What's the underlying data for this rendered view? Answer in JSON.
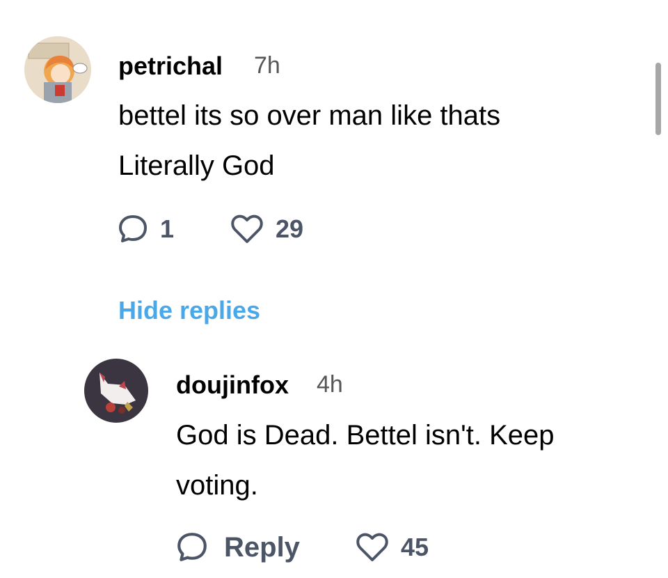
{
  "comments": [
    {
      "username": "petrichal",
      "time": "7h",
      "lines": [
        "bettel its so over man like thats",
        "Literally God"
      ],
      "reply_count": "1",
      "like_count": "29"
    }
  ],
  "hide_replies_label": "Hide replies",
  "replies": [
    {
      "username": "doujinfox",
      "time": "4h",
      "lines": [
        "God is Dead. Bettel isn't. Keep",
        "voting."
      ],
      "reply_label": "Reply",
      "like_count": "45"
    }
  ],
  "colors": {
    "link": "#4aa8e8",
    "icon": "#4b5566",
    "scrollbar": "#a7a7a7"
  },
  "icons": {
    "comment": "speech-bubble-icon",
    "like": "heart-icon"
  }
}
